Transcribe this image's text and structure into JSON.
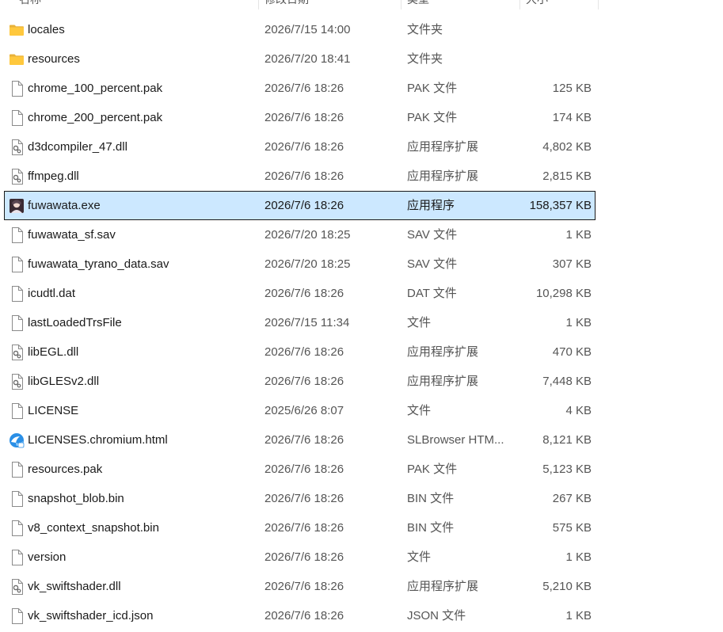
{
  "header": {
    "name": "名称",
    "date": "修改日期",
    "type": "类型",
    "size": "大小"
  },
  "files": [
    {
      "icon": "folder-icon",
      "name": "locales",
      "date": "2026/7/15 14:00",
      "type": "文件夹",
      "size": ""
    },
    {
      "icon": "folder-icon",
      "name": "resources",
      "date": "2026/7/20 18:41",
      "type": "文件夹",
      "size": ""
    },
    {
      "icon": "file-icon",
      "name": "chrome_100_percent.pak",
      "date": "2026/7/6 18:26",
      "type": "PAK 文件",
      "size": "125 KB"
    },
    {
      "icon": "file-icon",
      "name": "chrome_200_percent.pak",
      "date": "2026/7/6 18:26",
      "type": "PAK 文件",
      "size": "174 KB"
    },
    {
      "icon": "dll-icon",
      "name": "d3dcompiler_47.dll",
      "date": "2026/7/6 18:26",
      "type": "应用程序扩展",
      "size": "4,802 KB"
    },
    {
      "icon": "dll-icon",
      "name": "ffmpeg.dll",
      "date": "2026/7/6 18:26",
      "type": "应用程序扩展",
      "size": "2,815 KB"
    },
    {
      "icon": "app-icon",
      "name": "fuwawata.exe",
      "date": "2026/7/6 18:26",
      "type": "应用程序",
      "size": "158,357 KB",
      "selected": true
    },
    {
      "icon": "file-icon",
      "name": "fuwawata_sf.sav",
      "date": "2026/7/20 18:25",
      "type": "SAV 文件",
      "size": "1 KB"
    },
    {
      "icon": "file-icon",
      "name": "fuwawata_tyrano_data.sav",
      "date": "2026/7/20 18:25",
      "type": "SAV 文件",
      "size": "307 KB"
    },
    {
      "icon": "file-icon",
      "name": "icudtl.dat",
      "date": "2026/7/6 18:26",
      "type": "DAT 文件",
      "size": "10,298 KB"
    },
    {
      "icon": "file-icon",
      "name": "lastLoadedTrsFile",
      "date": "2026/7/15 11:34",
      "type": "文件",
      "size": "1 KB"
    },
    {
      "icon": "dll-icon",
      "name": "libEGL.dll",
      "date": "2026/7/6 18:26",
      "type": "应用程序扩展",
      "size": "470 KB"
    },
    {
      "icon": "dll-icon",
      "name": "libGLESv2.dll",
      "date": "2026/7/6 18:26",
      "type": "应用程序扩展",
      "size": "7,448 KB"
    },
    {
      "icon": "file-icon",
      "name": "LICENSE",
      "date": "2025/6/26 8:07",
      "type": "文件",
      "size": "4 KB"
    },
    {
      "icon": "browser-icon",
      "name": "LICENSES.chromium.html",
      "date": "2026/7/6 18:26",
      "type": "SLBrowser HTM...",
      "size": "8,121 KB"
    },
    {
      "icon": "file-icon",
      "name": "resources.pak",
      "date": "2026/7/6 18:26",
      "type": "PAK 文件",
      "size": "5,123 KB"
    },
    {
      "icon": "file-icon",
      "name": "snapshot_blob.bin",
      "date": "2026/7/6 18:26",
      "type": "BIN 文件",
      "size": "267 KB"
    },
    {
      "icon": "file-icon",
      "name": "v8_context_snapshot.bin",
      "date": "2026/7/6 18:26",
      "type": "BIN 文件",
      "size": "575 KB"
    },
    {
      "icon": "file-icon",
      "name": "version",
      "date": "2026/7/6 18:26",
      "type": "文件",
      "size": "1 KB"
    },
    {
      "icon": "dll-icon",
      "name": "vk_swiftshader.dll",
      "date": "2026/7/6 18:26",
      "type": "应用程序扩展",
      "size": "5,210 KB"
    },
    {
      "icon": "file-icon",
      "name": "vk_swiftshader_icd.json",
      "date": "2026/7/6 18:26",
      "type": "JSON 文件",
      "size": "1 KB"
    }
  ]
}
